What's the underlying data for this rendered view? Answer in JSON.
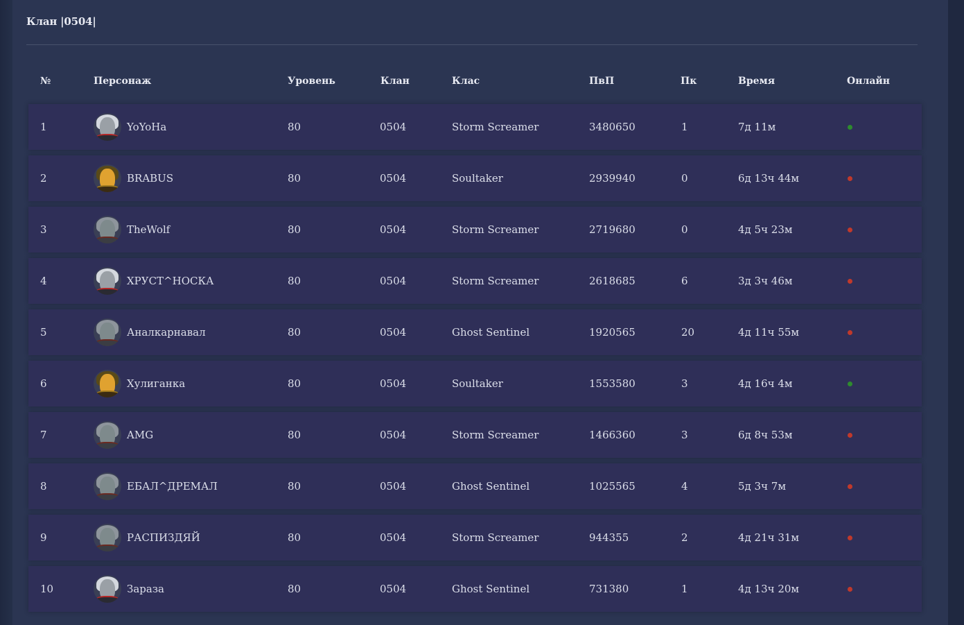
{
  "title": "Клан |0504|",
  "columns": {
    "num": "№",
    "character": "Персонаж",
    "level": "Уровень",
    "clan": "Клан",
    "class": "Клас",
    "pvp": "ПвП",
    "pk": "Пк",
    "time": "Время",
    "online": "Онлайн"
  },
  "status_colors": {
    "online": "#2e8b2e",
    "offline": "#c0392b"
  },
  "rows": [
    {
      "num": "1",
      "name": "YoYoHa",
      "avatar_icon": "dark-elf-avatar-icon",
      "level": "80",
      "clan": "0504",
      "class": "Storm Screamer",
      "pvp": "3480650",
      "pk": "1",
      "time": "7д 11м",
      "online": true
    },
    {
      "num": "2",
      "name": "BRABUS",
      "avatar_icon": "kamael-avatar-icon",
      "level": "80",
      "clan": "0504",
      "class": "Soultaker",
      "pvp": "2939940",
      "pk": "0",
      "time": "6д 13ч 44м",
      "online": false
    },
    {
      "num": "3",
      "name": "TheWolf",
      "avatar_icon": "dwarf-avatar-icon",
      "level": "80",
      "clan": "0504",
      "class": "Storm Screamer",
      "pvp": "2719680",
      "pk": "0",
      "time": "4д 5ч 23м",
      "online": false
    },
    {
      "num": "4",
      "name": "ХРУСТ^НОСКА",
      "avatar_icon": "dark-elf-avatar-icon",
      "level": "80",
      "clan": "0504",
      "class": "Storm Screamer",
      "pvp": "2618685",
      "pk": "6",
      "time": "3д 3ч 46м",
      "online": false
    },
    {
      "num": "5",
      "name": "Аналкарнавал",
      "avatar_icon": "dwarf-avatar-icon",
      "level": "80",
      "clan": "0504",
      "class": "Ghost Sentinel",
      "pvp": "1920565",
      "pk": "20",
      "time": "4д 11ч 55м",
      "online": false
    },
    {
      "num": "6",
      "name": "Хулиганка",
      "avatar_icon": "kamael-avatar-icon",
      "level": "80",
      "clan": "0504",
      "class": "Soultaker",
      "pvp": "1553580",
      "pk": "3",
      "time": "4д 16ч 4м",
      "online": true
    },
    {
      "num": "7",
      "name": "AMG",
      "avatar_icon": "dwarf-avatar-icon",
      "level": "80",
      "clan": "0504",
      "class": "Storm Screamer",
      "pvp": "1466360",
      "pk": "3",
      "time": "6д 8ч 53м",
      "online": false
    },
    {
      "num": "8",
      "name": "ЕБАЛ^ДРЕМАЛ",
      "avatar_icon": "dwarf-avatar-icon",
      "level": "80",
      "clan": "0504",
      "class": "Ghost Sentinel",
      "pvp": "1025565",
      "pk": "4",
      "time": "5д 3ч 7м",
      "online": false
    },
    {
      "num": "9",
      "name": "РАСПИЗДЯЙ",
      "avatar_icon": "dwarf-avatar-icon",
      "level": "80",
      "clan": "0504",
      "class": "Storm Screamer",
      "pvp": "944355",
      "pk": "2",
      "time": "4д 21ч 31м",
      "online": false
    },
    {
      "num": "10",
      "name": "Зараза",
      "avatar_icon": "dark-elf-avatar-icon",
      "level": "80",
      "clan": "0504",
      "class": "Ghost Sentinel",
      "pvp": "731380",
      "pk": "1",
      "time": "4д 13ч 20м",
      "online": false
    }
  ]
}
